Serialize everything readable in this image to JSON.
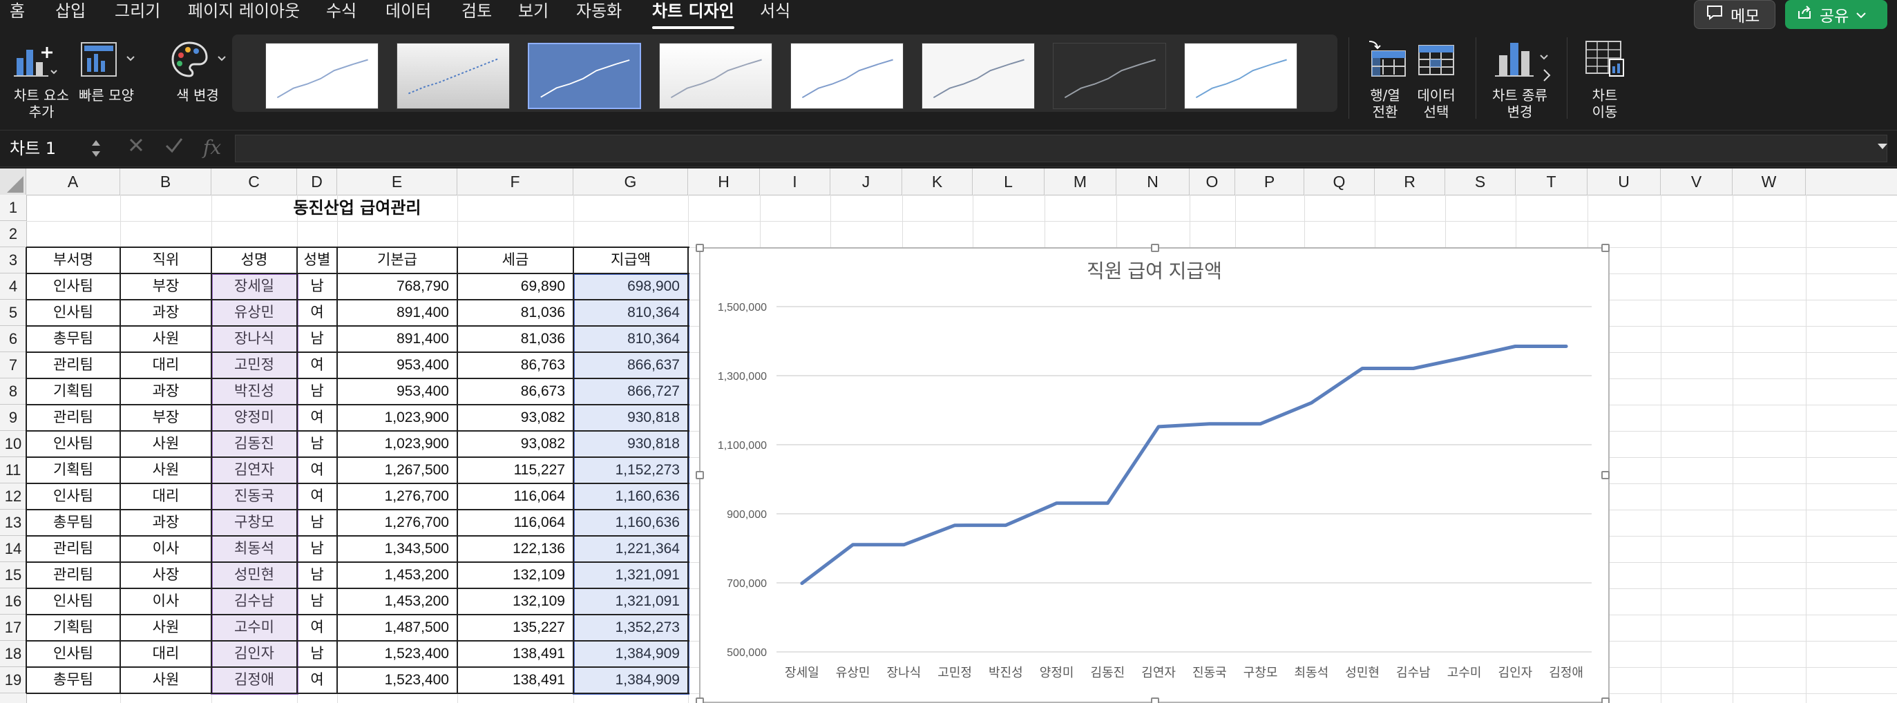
{
  "tabs": [
    "홈",
    "삽입",
    "그리기",
    "페이지 레이아웃",
    "수식",
    "데이터",
    "검토",
    "보기",
    "자동화",
    "차트 디자인",
    "서식"
  ],
  "active_tab": "차트 디자인",
  "header_buttons": {
    "memo": "메모",
    "share": "공유"
  },
  "ribbon": {
    "add_chart_element": "차트 요소\n추가",
    "quick_layout": "빠른 모양",
    "change_colors": "색 변경",
    "switch_row_col": "행/열\n전환",
    "select_data": "데이터\n선택",
    "change_chart_type": "차트 종류\n변경",
    "move_chart": "차트\n이동",
    "style_thumbnails": [
      "style-1",
      "style-2",
      "style-3",
      "style-4",
      "style-5",
      "style-6",
      "style-7",
      "style-8"
    ]
  },
  "formula_bar": {
    "name_box": "차트 1",
    "formula": ""
  },
  "columns": [
    "A",
    "B",
    "C",
    "D",
    "E",
    "F",
    "G",
    "H",
    "I",
    "J",
    "K",
    "L",
    "M",
    "N",
    "O",
    "P",
    "Q",
    "R",
    "S",
    "T",
    "U",
    "V",
    "W"
  ],
  "rows": [
    "1",
    "2",
    "3",
    "4",
    "5",
    "6",
    "7",
    "8",
    "9",
    "10",
    "11",
    "12",
    "13",
    "14",
    "15",
    "16",
    "17",
    "18",
    "19"
  ],
  "sheet": {
    "title": "동진산업 급여관리",
    "headers": [
      "부서명",
      "직위",
      "성명",
      "성별",
      "기본급",
      "세금",
      "지급액"
    ],
    "data": [
      [
        "인사팀",
        "부장",
        "장세일",
        "남",
        "768,790",
        "69,890",
        "698,900"
      ],
      [
        "인사팀",
        "과장",
        "유상민",
        "여",
        "891,400",
        "81,036",
        "810,364"
      ],
      [
        "총무팀",
        "사원",
        "장나식",
        "남",
        "891,400",
        "81,036",
        "810,364"
      ],
      [
        "관리팀",
        "대리",
        "고민정",
        "여",
        "953,400",
        "86,763",
        "866,637"
      ],
      [
        "기획팀",
        "과장",
        "박진성",
        "남",
        "953,400",
        "86,673",
        "866,727"
      ],
      [
        "관리팀",
        "부장",
        "양정미",
        "여",
        "1,023,900",
        "93,082",
        "930,818"
      ],
      [
        "인사팀",
        "사원",
        "김동진",
        "남",
        "1,023,900",
        "93,082",
        "930,818"
      ],
      [
        "기획팀",
        "사원",
        "김연자",
        "여",
        "1,267,500",
        "115,227",
        "1,152,273"
      ],
      [
        "인사팀",
        "대리",
        "진동국",
        "여",
        "1,276,700",
        "116,064",
        "1,160,636"
      ],
      [
        "총무팀",
        "과장",
        "구창모",
        "남",
        "1,276,700",
        "116,064",
        "1,160,636"
      ],
      [
        "관리팀",
        "이사",
        "최동석",
        "남",
        "1,343,500",
        "122,136",
        "1,221,364"
      ],
      [
        "관리팀",
        "사장",
        "성민현",
        "남",
        "1,453,200",
        "132,109",
        "1,321,091"
      ],
      [
        "인사팀",
        "이사",
        "김수남",
        "남",
        "1,453,200",
        "132,109",
        "1,321,091"
      ],
      [
        "기획팀",
        "사원",
        "고수미",
        "여",
        "1,487,500",
        "135,227",
        "1,352,273"
      ],
      [
        "인사팀",
        "대리",
        "김인자",
        "남",
        "1,523,400",
        "138,491",
        "1,384,909"
      ],
      [
        "총무팀",
        "사원",
        "김정애",
        "여",
        "1,523,400",
        "138,491",
        "1,384,909"
      ]
    ]
  },
  "chart_data": {
    "type": "line",
    "title": "직원 급여 지급액",
    "categories": [
      "장세일",
      "유상민",
      "장나식",
      "고민정",
      "박진성",
      "양정미",
      "김동진",
      "김연자",
      "진동국",
      "구창모",
      "최동석",
      "성민현",
      "김수남",
      "고수미",
      "김인자",
      "김정애"
    ],
    "values": [
      698900,
      810364,
      810364,
      866637,
      866727,
      930818,
      930818,
      1152273,
      1160636,
      1160636,
      1221364,
      1321091,
      1321091,
      1352273,
      1384909,
      1384909
    ],
    "ylim": [
      500000,
      1500000
    ],
    "yticks": [
      "1,500,000",
      "1,300,000",
      "1,100,000",
      "900,000",
      "700,000",
      "500,000"
    ],
    "line_color": "#5b7fbd",
    "grid": true,
    "legend": "none"
  }
}
